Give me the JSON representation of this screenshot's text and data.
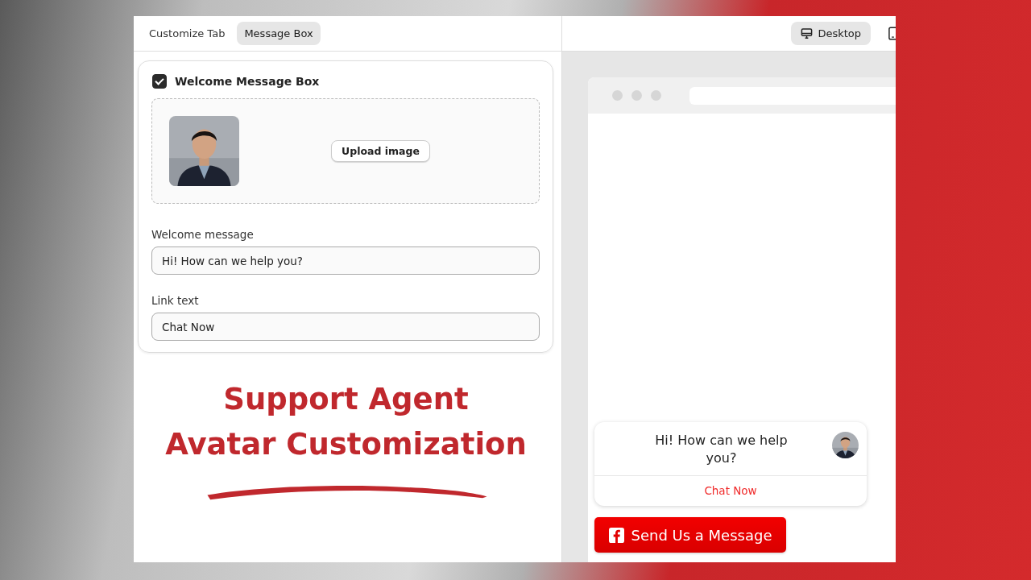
{
  "tabs": [
    {
      "label": "Customize Tab",
      "selected": false
    },
    {
      "label": "Message Box",
      "selected": true
    }
  ],
  "device_buttons": [
    {
      "kind": "desktop",
      "label": "Desktop",
      "selected": true
    },
    {
      "kind": "mobile",
      "selected": false
    }
  ],
  "settings": {
    "checked": true,
    "title": "Welcome Message Box",
    "upload_button": "Upload image",
    "fields": [
      {
        "label": "Welcome message",
        "value": "Hi! How can we help you?"
      },
      {
        "label": "Link text",
        "value": "Chat Now"
      }
    ]
  },
  "headline": [
    "Support Agent",
    "Avatar Customization"
  ],
  "preview": {
    "message": "Hi! How can we help you?",
    "link": "Chat Now",
    "send_button": "Send Us a Message"
  }
}
